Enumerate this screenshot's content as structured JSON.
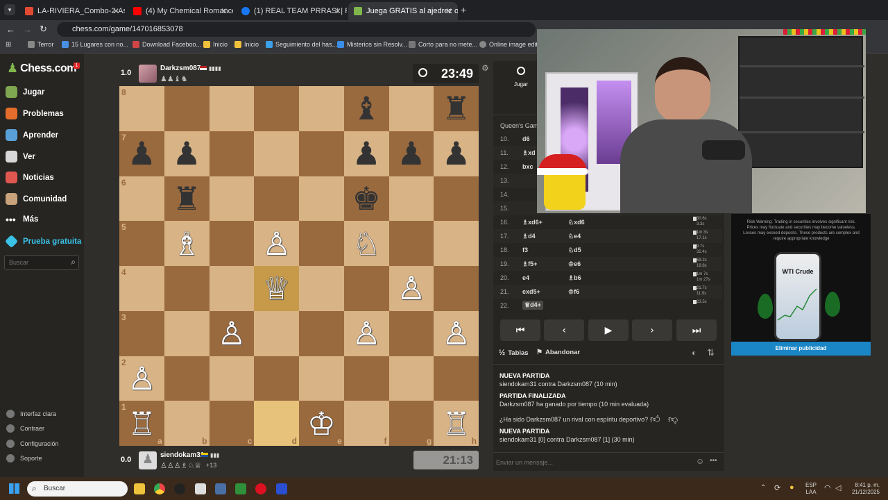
{
  "browser": {
    "tabs": [
      {
        "label": "LA-RIVIERA_Combo-2-Asados-",
        "favicon_color": "#e24a33"
      },
      {
        "label": "(4) My Chemical Romance",
        "favicon_color": "#ff0000"
      },
      {
        "label": "(1) REAL TEAM PRRAS! | Facebo",
        "favicon_color": "#1877f2"
      },
      {
        "label": "Juega GRATIS al ajedrez online",
        "favicon_color": "#81b64c"
      }
    ],
    "url": "chess.com/game/147016853078",
    "bookmarks": [
      "Terror",
      "15 Lugares con no...",
      "Download Faceboo...",
      "Inicio",
      "Inicio",
      "Seguimiento del has...",
      "Misterios sin Resolv...",
      "Corto para no mete...",
      "Online image editor"
    ]
  },
  "sidebar": {
    "logo": "Chess.com",
    "badge": "1",
    "items": [
      {
        "label": "Jugar",
        "color": "#7fa650"
      },
      {
        "label": "Problemas",
        "color": "#e46d2b"
      },
      {
        "label": "Aprender",
        "color": "#5aa0d8"
      },
      {
        "label": "Ver",
        "color": "#d8d8d8"
      },
      {
        "label": "Noticias",
        "color": "#e0574f"
      },
      {
        "label": "Comunidad",
        "color": "#c8a27a"
      },
      {
        "label": "Más",
        "color": "#cccccc"
      },
      {
        "label": "Prueba gratuita",
        "color": "#39c1e6"
      }
    ],
    "search_placeholder": "Buscar",
    "bottom": [
      "Interfaz clara",
      "Contraer",
      "Configuración",
      "Soporte"
    ]
  },
  "top_player": {
    "score": "1.0",
    "name": "Darkzsm087",
    "captured": "♟♟♝♞",
    "clock": "23:49"
  },
  "bottom_player": {
    "score": "0.0",
    "name": "siendokam31",
    "captured": "♙♙♙♗♘♕",
    "advantage": "+13",
    "clock": "21:13"
  },
  "board": {
    "ranks": [
      "8",
      "7",
      "6",
      "5",
      "4",
      "3",
      "2",
      "1"
    ],
    "files": [
      "a",
      "b",
      "c",
      "d",
      "e",
      "f",
      "g",
      "h"
    ],
    "position": [
      [
        "",
        "",
        "",
        "",
        "",
        "♝",
        "",
        "♜"
      ],
      [
        "♟",
        "♟",
        "",
        "",
        "",
        "♟",
        "♟",
        "♟"
      ],
      [
        "",
        "♜",
        "",
        "",
        "",
        "♚",
        "",
        ""
      ],
      [
        "",
        "♗",
        "",
        "♙",
        "",
        "♘",
        "",
        ""
      ],
      [
        "",
        "",
        "",
        "♕",
        "",
        "",
        "♙",
        ""
      ],
      [
        "",
        "",
        "♙",
        "",
        "",
        "♙",
        "",
        "♙"
      ],
      [
        "♙",
        "",
        "",
        "",
        "",
        "",
        "",
        ""
      ],
      [
        "♖",
        "",
        "",
        "",
        "♔",
        "",
        "",
        "♖"
      ]
    ],
    "piece_colors": [
      [
        "",
        "",
        "",
        "",
        "",
        "b",
        "",
        "b"
      ],
      [
        "b",
        "b",
        "",
        "",
        "",
        "b",
        "b",
        "b"
      ],
      [
        "",
        "b",
        "",
        "",
        "",
        "b",
        "",
        ""
      ],
      [
        "",
        "w",
        "",
        "w",
        "",
        "w",
        "",
        ""
      ],
      [
        "",
        "",
        "",
        "w",
        "",
        "",
        "w",
        ""
      ],
      [
        "",
        "",
        "w",
        "",
        "",
        "w",
        "",
        "w"
      ],
      [
        "w",
        "",
        "",
        "",
        "",
        "",
        "",
        ""
      ],
      [
        "w",
        "",
        "",
        "",
        "w",
        "",
        "",
        "w"
      ]
    ],
    "highlighted": [
      "d4",
      "d1"
    ]
  },
  "panel": {
    "tab_play": "Jugar",
    "opening": "Queen's Gambi",
    "moves": [
      {
        "n": "10.",
        "w": "d6",
        "b": ""
      },
      {
        "n": "11.",
        "w": "♗xd",
        "b": ""
      },
      {
        "n": "12.",
        "w": "bxc",
        "b": ""
      },
      {
        "n": "13.",
        "w": "",
        "b": ""
      },
      {
        "n": "14.",
        "w": "",
        "b": ""
      },
      {
        "n": "15.",
        "w": "",
        "b": ""
      },
      {
        "n": "16.",
        "w": "♗xd6+",
        "b": "♘xd6",
        "tw": "30.6s",
        "tb": "3.3s"
      },
      {
        "n": "17.",
        "w": "♗d4",
        "b": "♘e4",
        "tw": "1m 3s",
        "tb": "17.1s"
      },
      {
        "n": "18.",
        "w": "f3",
        "b": "♘d5",
        "tw": "9.7s",
        "tb": "32.4s"
      },
      {
        "n": "19.",
        "w": "♗f5+",
        "b": "♔e6",
        "tw": "59.2s",
        "tb": "19.8s"
      },
      {
        "n": "20.",
        "w": "e4",
        "b": "♗b6",
        "tw": "1m 7s",
        "tb": "1m 27s"
      },
      {
        "n": "21.",
        "w": "exd5+",
        "b": "♔f6",
        "tw": "21.7s",
        "tb": "11.9s"
      },
      {
        "n": "22.",
        "w": "♕d4+",
        "b": "",
        "tw": "23.5s",
        "tb": ""
      }
    ],
    "draw_label": "Tablas",
    "resign_label": "Abandonar",
    "log": [
      {
        "title": "NUEVA PARTIDA",
        "text": "siendokam31 contra Darkzsm087 (10 min)"
      },
      {
        "title": "PARTIDA FINALIZADA",
        "text": "Darkzsm087 ha ganado por tiempo (10 min evaluada)"
      },
      {
        "title": "",
        "text": "¿Ha sido Darkzsm087 un rival con espíritu deportivo?"
      },
      {
        "title": "NUEVA PARTIDA",
        "text": "siendokam31 [0] contra Darkzsm087 [1] (30 min)"
      }
    ],
    "chat_placeholder": "Enviar un mensaje..."
  },
  "ad": {
    "warning": "Risk Warning: Trading in securities involves significant risk. Prices may fluctuate and securities may become valueless. Losses may exceed deposits. These products are complex and require appropriate knowledge",
    "product": "WTI Crude",
    "remove_label": "Eliminar publicidad"
  },
  "taskbar": {
    "search_placeholder": "Buscar",
    "lang_top": "ESP",
    "lang_bottom": "LAA",
    "time": "8:41 p. m.",
    "date": "21/12/2025"
  }
}
